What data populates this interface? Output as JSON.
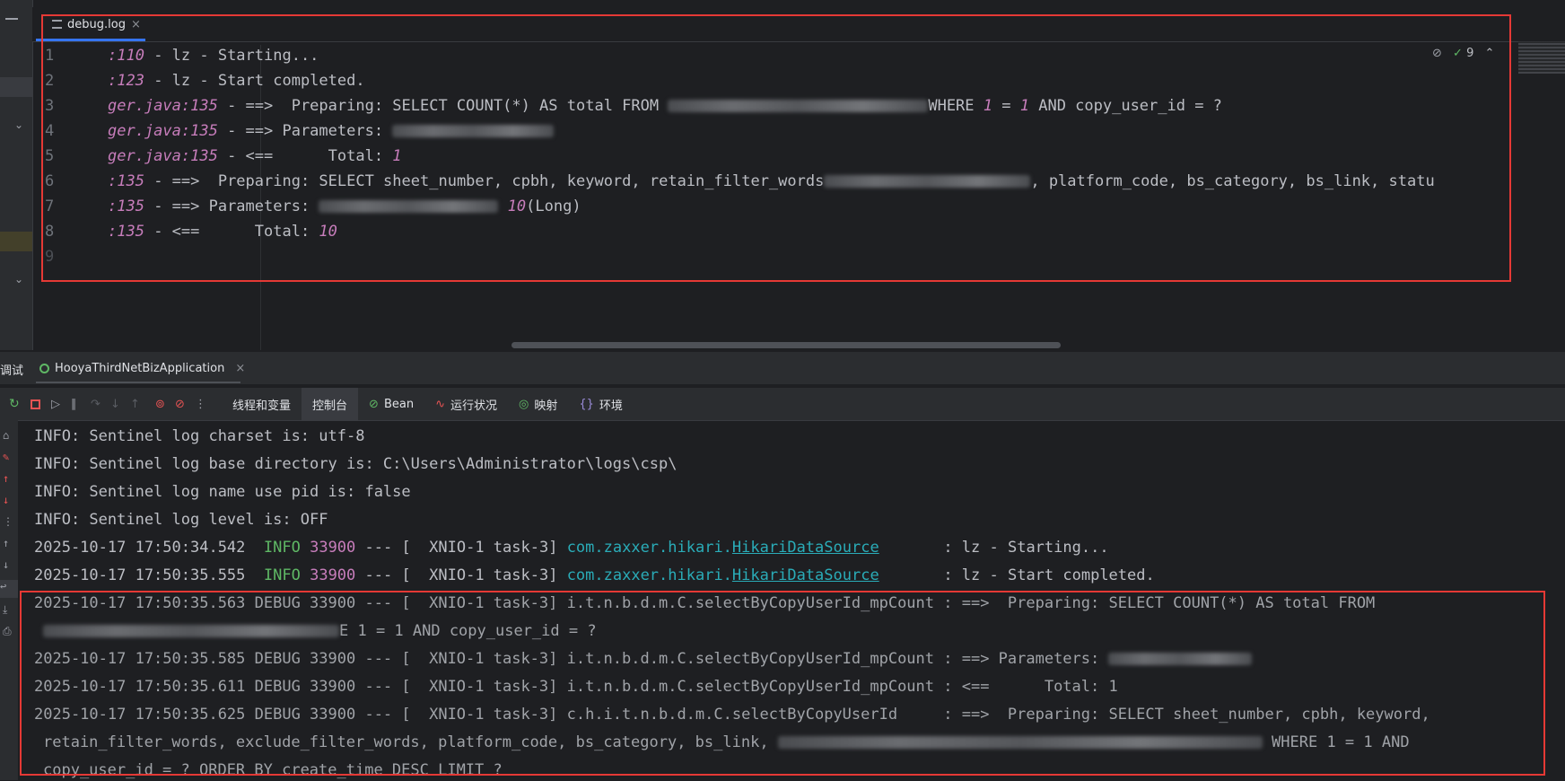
{
  "editor": {
    "tab_label": "debug.log",
    "tab_close": "×",
    "inspection_count": "9",
    "line_numbers": [
      "1",
      "2",
      "3",
      "4",
      "5",
      "6",
      "7",
      "8",
      "9"
    ],
    "lines": [
      {
        "a": ":110",
        "b": " - lz - Starting..."
      },
      {
        "a": ":123",
        "b": " - lz - Start completed."
      },
      {
        "a": "ger.java:135",
        "b": " - ==>  Preparing: SELECT COUNT(*) AS total FROM ",
        "c": "WHERE ",
        "n1": "1",
        "d": " = ",
        "n2": "1",
        "e": " AND copy_user_id = ?"
      },
      {
        "a": "ger.java:135",
        "b": " - ==> Parameters: "
      },
      {
        "a": "ger.java:135",
        "b": " - <==      Total: ",
        "n1": "1"
      },
      {
        "a": ":135",
        "b": " - ==>  Preparing: SELECT sheet_number, cpbh, keyword, retain_filter_words",
        "c": ", platform_code, bs_category, bs_link, statu"
      },
      {
        "a": ":135",
        "b": " - ==> Parameters: ",
        "n1": "10",
        "c": "(Long)"
      },
      {
        "a": ":135",
        "b": " - <==      Total: ",
        "n1": "10"
      }
    ]
  },
  "run": {
    "tab_prefix": "调试",
    "app_tab": "HooyaThirdNetBizApplication",
    "app_tab_close": "×",
    "toolbar": {
      "threads": "线程和变量",
      "console": "控制台",
      "bean": "Bean",
      "health": "运行状况",
      "mapping": "映射",
      "env": "环境"
    },
    "console_lines": [
      "INFO: Sentinel log charset is: utf-8",
      "INFO: Sentinel log base directory is: C:\\Users\\Administrator\\logs\\csp\\",
      "INFO: Sentinel log name use pid is: false",
      "INFO: Sentinel log level is: OFF"
    ],
    "log_entries": [
      {
        "ts": "2025-10-17 17:50:34.542",
        "level": "INFO",
        "pid": "33900",
        "mid": " --- [  XNIO-1 task-3] ",
        "logger1": "com.zaxxer.hikari.",
        "logger2": "HikariDataSource",
        "msg": "       : lz - Starting..."
      },
      {
        "ts": "2025-10-17 17:50:35.555",
        "level": "INFO",
        "pid": "33900",
        "mid": " --- [  XNIO-1 task-3] ",
        "logger1": "com.zaxxer.hikari.",
        "logger2": "HikariDataSource",
        "msg": "       : lz - Start completed."
      }
    ],
    "debug_lines": [
      "2025-10-17 17:50:35.563 DEBUG 33900 --- [  XNIO-1 task-3] i.t.n.b.d.m.C.selectByCopyUserId_mpCount : ==>  Preparing: SELECT COUNT(*) AS total FROM",
      "E 1 = 1 AND copy_user_id = ?",
      "2025-10-17 17:50:35.585 DEBUG 33900 --- [  XNIO-1 task-3] i.t.n.b.d.m.C.selectByCopyUserId_mpCount : ==> Parameters: ",
      "2025-10-17 17:50:35.611 DEBUG 33900 --- [  XNIO-1 task-3] i.t.n.b.d.m.C.selectByCopyUserId_mpCount : <==      Total: 1",
      "2025-10-17 17:50:35.625 DEBUG 33900 --- [  XNIO-1 task-3] c.h.i.t.n.b.d.m.C.selectByCopyUserId     : ==>  Preparing: SELECT sheet_number, cpbh, keyword,",
      "retain_filter_words, exclude_filter_words, platform_code, bs_category, bs_link, ",
      "WHERE 1 = 1 AND",
      "copy_user_id = ? ORDER BY create_time DESC LIMIT ?"
    ]
  }
}
